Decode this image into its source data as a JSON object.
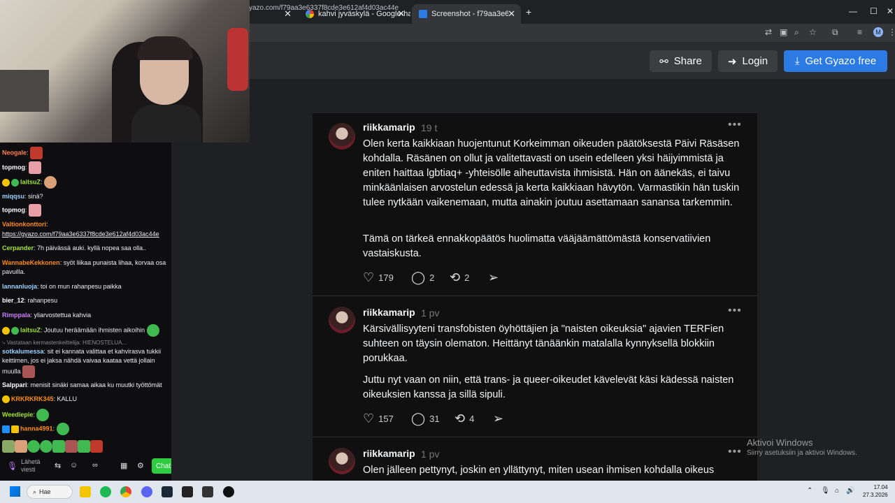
{
  "browser": {
    "tabs": [
      {
        "title": "kahvi jyväskylä - Google-haku"
      },
      {
        "title": "Screenshot - f79aa3e6337f8cde"
      }
    ],
    "url": "yazo.com/f79aa3e6337f8cde3e612af4d03ac44e",
    "profile_initial": "M"
  },
  "gyazo": {
    "share_label": "Share",
    "login_label": "Login",
    "get_label": "Get Gyazo free"
  },
  "posts": [
    {
      "user": "riikkamarip",
      "time": "19 t",
      "paragraphs": [
        "Olen kerta kaikkiaan huojentunut Korkeimman oikeuden päätöksestä Päivi Räsäsen kohdalla. Räsänen on ollut ja valitettavasti on usein edelleen yksi häijyimmistä ja eniten haittaa lgbtiaq+ -yhteisölle aiheuttavista ihmisistä. Hän on äänekäs, ei taivu minkäänlaisen arvostelun edessä ja kerta kaikkiaan hävytön. Varmastikin hän tuskin tulee nytkään vaikenemaan, mutta ainakin joutuu asettamaan sanansa tarkemmin.",
        "Tämä on tärkeä ennakkopäätös huolimatta vääjäämättömästä konservatiivien vastaiskusta."
      ],
      "likes": "179",
      "replies": "2",
      "reposts": "2"
    },
    {
      "user": "riikkamarip",
      "time": "1 pv",
      "paragraphs": [
        "Kärsivällisyyteni transfobisten öyhöttäjien ja \"naisten oikeuksia\" ajavien TERFien suhteen on täysin olematon. Heittänyt tänäänkin matalalla kynnyksellä blokkiin porukkaa.",
        "Juttu nyt vaan on niin, että trans- ja queer-oikeudet kävelevät käsi kädessä naisten oikeuksien kanssa ja sillä sipuli."
      ],
      "likes": "157",
      "replies": "31",
      "reposts": "4"
    },
    {
      "user": "riikkamarip",
      "time": "1 pv",
      "paragraphs": [
        "Olen jälleen pettynyt, joskin en yllättynyt, miten usean ihmisen kohdalla oikeus"
      ]
    }
  ],
  "windows_activation": {
    "title": "Aktivoi Windows",
    "subtitle": "Siirry asetuksiin ja aktivoi Windows."
  },
  "chat": {
    "messages": [
      {
        "user": "Neogale",
        "color": "#ff7f50",
        "text": ""
      },
      {
        "user": "topmog",
        "color": "#ffffff",
        "text": ""
      },
      {
        "user": "laitsuZ",
        "color": "#a3e635",
        "text": ""
      },
      {
        "user": "miqqsu",
        "color": "#9ad1ff",
        "text": "sinä?"
      },
      {
        "user": "topmog",
        "color": "#ffffff",
        "text": ""
      },
      {
        "user": "Valtionkonttori",
        "color": "#ff8c1a",
        "text": ""
      },
      {
        "user": "",
        "color": "#ffffff",
        "text": "https://gyazo.com/f79aa3e6337f8cde3e612af4d03ac44e"
      },
      {
        "user": "Cerpander",
        "color": "#a3e635",
        "text": "7h päivässä auki. kyllä nopea saa olla.."
      },
      {
        "user": "WannabeKekkonen",
        "color": "#ff8c1a",
        "text": "syöt liikaa punaista lihaa, korvaa osa pavuilla."
      },
      {
        "user": "lannanluoja",
        "color": "#9ad1ff",
        "text": "toi on mun rahanpesu paikka"
      },
      {
        "user": "bier_12",
        "color": "#ffffff",
        "text": "rahanpesu"
      },
      {
        "user": "Rimppala",
        "color": "#c77dff",
        "text": "yliarvostettua kahvia"
      },
      {
        "user": "laitsuZ",
        "color": "#a3e635",
        "text": "Joutuu heräämään ihmisten aikoihin"
      },
      {
        "user": "",
        "color": "#8a8a8a",
        "text": "Vastataan kermastenkeittelija: HIENOSTELUA..."
      },
      {
        "user": "sotkalumessa",
        "color": "#9ad1ff",
        "text": "sit ei kannata valittaa et kahvirasva tukkii keittimen, jos ei jaksa nähdä vaivaa kaataa vettä jollain muulla"
      },
      {
        "user": "Salppari",
        "color": "#ffffff",
        "text": "menisit sinäki samaa aikaa ku muutki työttömät"
      },
      {
        "user": "KRKRKRK345",
        "color": "#ff8c1a",
        "text": "KALLU"
      },
      {
        "user": "Weediepie",
        "color": "#a3e635",
        "text": ""
      },
      {
        "user": "hanna4991",
        "color": "#ff8c1a",
        "text": ""
      }
    ],
    "input_placeholder": "Lähetä viesti",
    "chat_button": "Chat"
  },
  "taskbar": {
    "search_label": "Hae",
    "time": "17.04",
    "date": "27.3.2026"
  }
}
